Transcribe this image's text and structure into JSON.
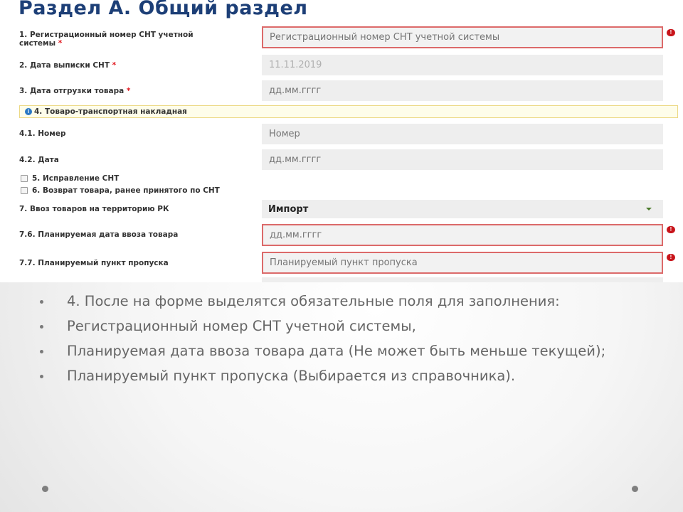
{
  "form": {
    "title": "Раздел А. Общий раздел",
    "required_mark": "*",
    "fields": {
      "f1": {
        "label_line1": "1. Регистрационный номер СНТ учетной",
        "label_line2": "системы",
        "placeholder": "Регистрационный номер СНТ учетной системы"
      },
      "f2": {
        "label": "2. Дата выписки СНТ",
        "value": "11.11.2019"
      },
      "f3": {
        "label": "3. Дата отгрузки товара",
        "placeholder": "дд.мм.гггг"
      },
      "banner": {
        "icon": "info-icon",
        "label": "4. Товаро-транспортная накладная"
      },
      "f41": {
        "label": "4.1. Номер",
        "placeholder": "Номер"
      },
      "f42": {
        "label": "4.2. Дата",
        "placeholder": "дд.мм.гггг"
      },
      "cb5": {
        "label": "5. Исправление СНТ",
        "checked": false
      },
      "cb6": {
        "label": "6. Возврат товара, ранее принятого по СНТ",
        "checked": false
      },
      "f7": {
        "label": "7. Ввоз товаров на территорию РК",
        "value": "Импорт"
      },
      "f76": {
        "label": "7.6. Планируемая дата ввоза товара",
        "placeholder": "дд.мм.гггг"
      },
      "f77": {
        "label": "7.7. Планируемый пункт пропуска",
        "placeholder": "Планируемый пункт пропуска"
      }
    },
    "error_icon": "alert-circle-icon",
    "colors": {
      "title": "#1d3f77",
      "error_border": "#dc6a6a",
      "error_icon": "#c8141a",
      "banner_bg": "#fefdea",
      "info_icon": "#2a78c4"
    }
  },
  "slide": {
    "bullets": [
      "4. После на форме выделятся обязательные поля для заполнения:",
      "Регистрационный номер СНТ учетной системы,",
      "Планируемая дата ввоза товара дата (Не может быть меньше текущей);",
      "Планируемый пункт пропуска (Выбирается из справочника)."
    ]
  }
}
